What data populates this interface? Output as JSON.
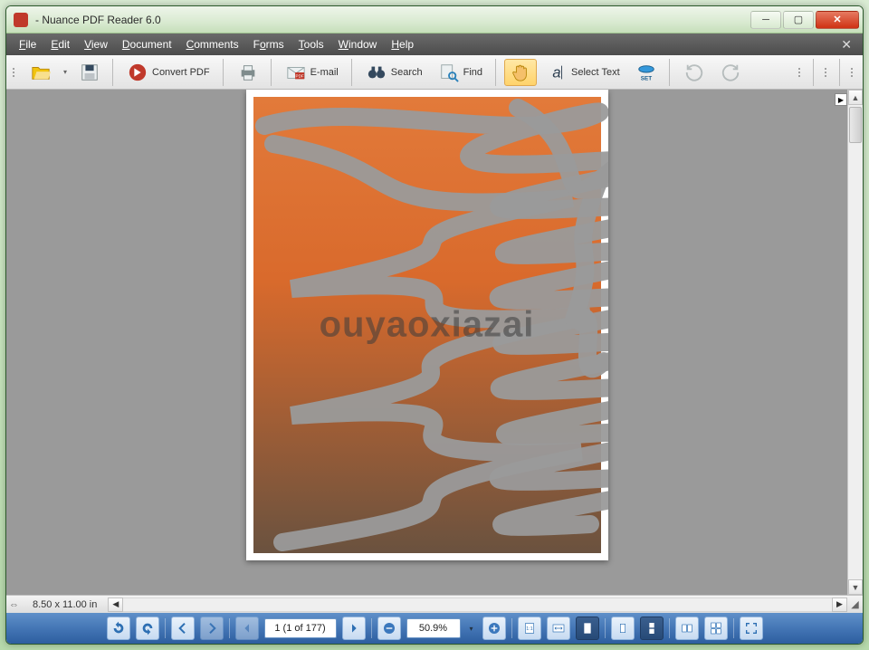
{
  "window": {
    "title": "- Nuance PDF Reader 6.0"
  },
  "menu": {
    "items": [
      {
        "label": "File",
        "key": "F"
      },
      {
        "label": "Edit",
        "key": "E"
      },
      {
        "label": "View",
        "key": "V"
      },
      {
        "label": "Document",
        "key": "D"
      },
      {
        "label": "Comments",
        "key": "C"
      },
      {
        "label": "Forms",
        "key": "F"
      },
      {
        "label": "Tools",
        "key": "T"
      },
      {
        "label": "Window",
        "key": "W"
      },
      {
        "label": "Help",
        "key": "H"
      }
    ]
  },
  "toolbar": {
    "convert_label": "Convert PDF",
    "email_label": "E-mail",
    "search_label": "Search",
    "find_label": "Find",
    "select_text_label": "Select Text"
  },
  "document": {
    "watermark": "ouyaoxiazai"
  },
  "status": {
    "page_dimensions": "8.50 x 11.00 in"
  },
  "footer": {
    "page_field": "1 (1 of 177)",
    "zoom_field": "50.9%"
  }
}
